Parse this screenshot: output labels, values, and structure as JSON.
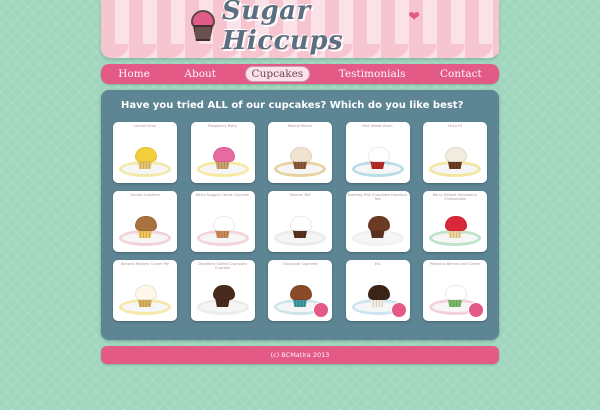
{
  "brand": {
    "name": "Sugar Hiccups",
    "cup_icon": "cupcake-icon",
    "heart_icon": "heart-icon",
    "accent": "#e35a86"
  },
  "nav": {
    "items": [
      {
        "label": "Home",
        "active": false
      },
      {
        "label": "About",
        "active": false
      },
      {
        "label": "Cupcakes",
        "active": true
      },
      {
        "label": "Testimonials",
        "active": false
      },
      {
        "label": "Contact",
        "active": false
      }
    ]
  },
  "main": {
    "title": "Have you tried ALL of our cupcakes? Which do you like best?",
    "cupcakes": [
      {
        "label": "Lemon Drop",
        "frosting": "#f3cf3e",
        "cake": "#e8c46e",
        "plate": "#f0e9a8"
      },
      {
        "label": "Raspberry Ruby",
        "frosting": "#e86aa0",
        "cake": "#c9a16a",
        "plate": "#f7eaa0"
      },
      {
        "label": "Mocha Moron",
        "frosting": "#f0e4d0",
        "cake": "#8a5a3a",
        "plate": "#e9d2a2"
      },
      {
        "label": "Red Velvet Vixen",
        "frosting": "#ffffff",
        "cake": "#b72a2a",
        "plate": "#b9dde6"
      },
      {
        "label": "Hi-Lo Hi",
        "frosting": "#f2ece0",
        "cake": "#6b3b22",
        "plate": "#f1e7a0"
      },
      {
        "label": "Vanilla Sunshine",
        "frosting": "#a9723f",
        "cake": "#f0c65c",
        "plate": "#f4d1da"
      },
      {
        "label": "Berry Nugget Carrot Cupcake",
        "frosting": "#ffffff",
        "cake": "#c88a5a",
        "plate": "#f6d2dc"
      },
      {
        "label": "Smores Tart",
        "frosting": "#ffffff",
        "cake": "#5a3220",
        "plate": "#ececec"
      },
      {
        "label": "Nutmeg Milk Chocolate Hazelnut Tart",
        "frosting": "#6b3b22",
        "cake": "#5a3220",
        "plate": "#eef2f5"
      },
      {
        "label": "Berry Delight Strawberry Cheesecake",
        "frosting": "#d8283a",
        "cake": "#ecd6a0",
        "plate": "#bde3c8"
      },
      {
        "label": "Banana Monkey Cream Pie",
        "frosting": "#fff8e8",
        "cake": "#d7b061",
        "plate": "#f4e9a6"
      },
      {
        "label": "Decadent Salted Chocolate Cupcake",
        "frosting": "#4a2a1c",
        "cake": "#4a2a1c",
        "plate": "#ececec"
      },
      {
        "label": "Chocolate Supreme",
        "frosting": "#8a4a2a",
        "cake": "#3f9aa3",
        "plate": "#cfe5ea"
      },
      {
        "label": "Ero",
        "frosting": "#3a2418",
        "cake": "#f2ece0",
        "plate": "#cce5f0"
      },
      {
        "label": "Pistachio Berries and Cream",
        "frosting": "#ffffff",
        "cake": "#7bb867",
        "plate": "#f4d1da"
      }
    ]
  },
  "footer": {
    "text": "(c) BCMatira 2013"
  }
}
